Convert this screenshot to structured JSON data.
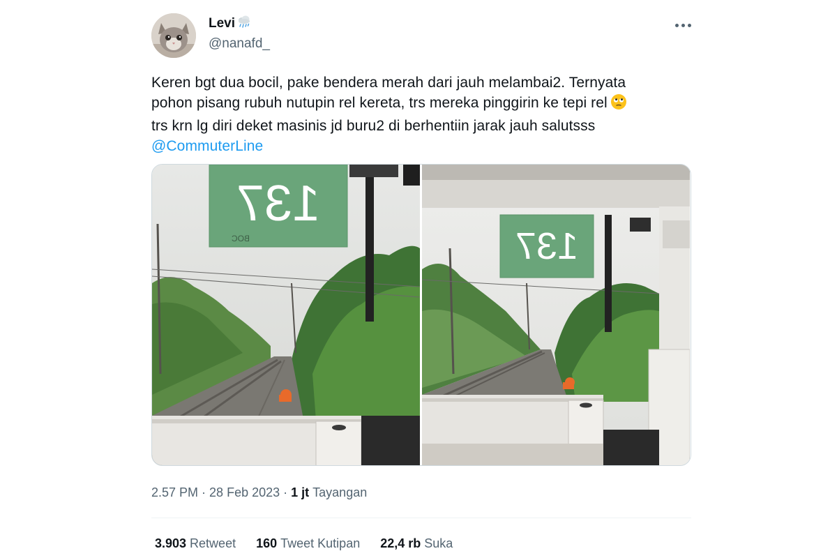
{
  "author": {
    "display_name": "Levi",
    "name_emoji_icon": "cloud-with-rain-icon",
    "handle": "@nanafd_",
    "avatar_icon": "cat-avatar"
  },
  "more_menu_icon": "more-horizontal-icon",
  "tweet": {
    "lines": [
      "Keren bgt dua bocil, pake bendera merah dari jauh melambai2. Ternyata",
      "pohon pisang rubuh nutupin rel kereta, trs mereka pinggirin ke tepi rel",
      "trs krn lg diri deket masinis jd buru2 di berhentiin jarak jauh salutsss"
    ],
    "inline_emoji_icon": "face-with-rolling-eyes-icon",
    "mention": "@CommuterLine"
  },
  "media": {
    "photos": [
      {
        "sign_text": "137"
      },
      {
        "sign_text": "137"
      }
    ]
  },
  "meta": {
    "time": "2.57 PM",
    "separator": "·",
    "date": "28 Feb 2023",
    "views_count": "1 jt",
    "views_label": "Tayangan"
  },
  "stats": {
    "retweets_count": "3.903",
    "retweets_label": "Retweet",
    "quotes_count": "160",
    "quotes_label": "Tweet Kutipan",
    "likes_count": "22,4 rb",
    "likes_label": "Suka"
  },
  "colors": {
    "link": "#1d9bf0",
    "primary_text": "#0f1419",
    "secondary_text": "#536471",
    "sign_green": "#6aa57a"
  }
}
